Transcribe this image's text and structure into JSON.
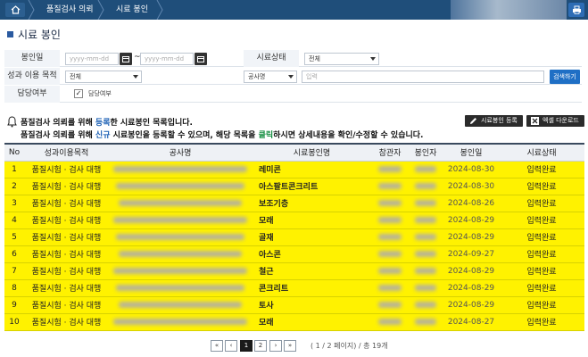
{
  "breadcrumb": [
    "품질검사 의뢰",
    "시료 봉인"
  ],
  "page_title": "시료 봉인",
  "form": {
    "seal_date_label": "봉인일",
    "date_from_placeholder": "yyyy-mm-dd",
    "date_sep": "~",
    "date_to_placeholder": "yyyy-mm-dd",
    "status_label": "시료상태",
    "status_value": "전체",
    "purpose_label": "성과 이용 목적",
    "purpose_value": "전체",
    "search_field_value": "공사명",
    "keyword_placeholder": "입력",
    "search_button": "검색하기",
    "charge_label": "담당여부",
    "charge_check_label": "담당여부",
    "charge_checked": "✓"
  },
  "notice": {
    "line1_a": "품질검사 의뢰를 위해 ",
    "line1_b": "등록",
    "line1_c": "한 시료봉인 목록입니다.",
    "line2_a": "품질검사 의뢰를 위해 ",
    "line2_b": "신규",
    "line2_c": " 시료봉인을 등록할 수 있으며, 해당 목록을 ",
    "line2_d": "클릭",
    "line2_e": "하시면 상세내용을 확인/수정할 수 있습니다."
  },
  "buttons": {
    "register": "시료봉인 등록",
    "excel": "엑셀 다운로드"
  },
  "table": {
    "headers": [
      "No",
      "성과이용목적",
      "공사명",
      "시료봉인명",
      "참관자",
      "봉인자",
      "봉인일",
      "시료상태"
    ],
    "rows": [
      {
        "no": "1",
        "purpose": "품질시험 · 검사 대행",
        "name": "레미콘",
        "date": "2024-08-30",
        "status": "입력완료"
      },
      {
        "no": "2",
        "purpose": "품질시험 · 검사 대행",
        "name": "아스팔트콘크리트",
        "date": "2024-08-30",
        "status": "입력완료"
      },
      {
        "no": "3",
        "purpose": "품질시험 · 검사 대행",
        "name": "보조기층",
        "date": "2024-08-26",
        "status": "입력완료"
      },
      {
        "no": "4",
        "purpose": "품질시험 · 검사 대행",
        "name": "모래",
        "date": "2024-08-29",
        "status": "입력완료"
      },
      {
        "no": "5",
        "purpose": "품질시험 · 검사 대행",
        "name": "골재",
        "date": "2024-08-29",
        "status": "입력완료"
      },
      {
        "no": "6",
        "purpose": "품질시험 · 검사 대행",
        "name": "아스콘",
        "date": "2024-09-27",
        "status": "입력완료"
      },
      {
        "no": "7",
        "purpose": "품질시험 · 검사 대행",
        "name": "철근",
        "date": "2024-08-29",
        "status": "입력완료"
      },
      {
        "no": "8",
        "purpose": "품질시험 · 검사 대행",
        "name": "콘크리트",
        "date": "2024-08-29",
        "status": "입력완료"
      },
      {
        "no": "9",
        "purpose": "품질시험 · 검사 대행",
        "name": "토사",
        "date": "2024-08-29",
        "status": "입력완료"
      },
      {
        "no": "10",
        "purpose": "품질시험 · 검사 대행",
        "name": "모래",
        "date": "2024-08-27",
        "status": "입력완료"
      }
    ]
  },
  "pagination": {
    "first": "«",
    "prev": "‹",
    "page1": "1",
    "page2": "2",
    "next": "›",
    "last": "»",
    "info": "( 1 / 2 페이지) / 총 19개"
  },
  "colors": {
    "row_highlight": "#fff200",
    "header_bar": "#1f4e7a",
    "accent": "#1f6fc5"
  }
}
